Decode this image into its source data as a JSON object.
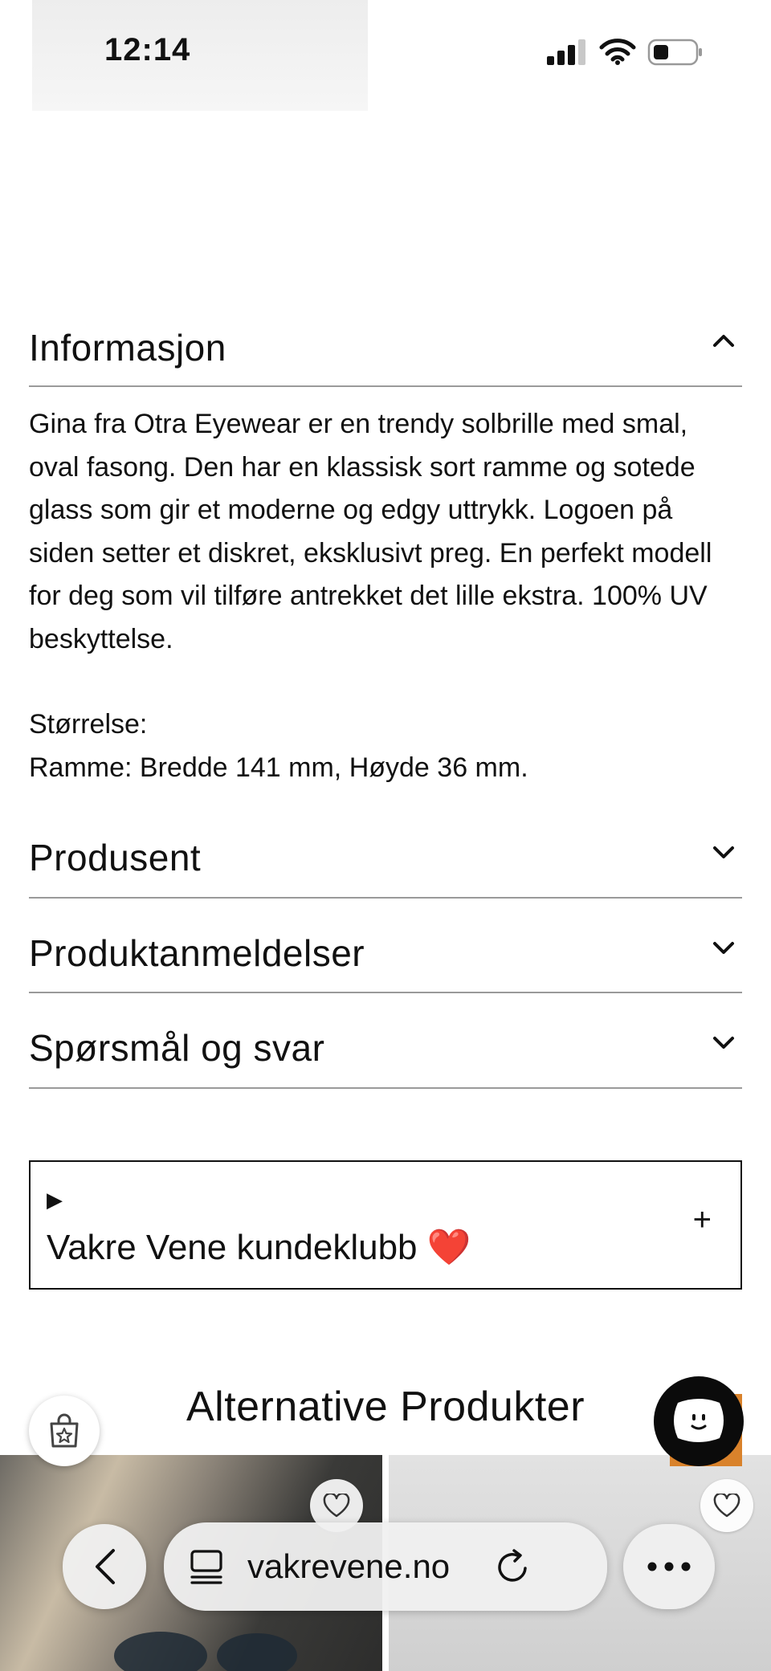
{
  "status_bar": {
    "time": "12:14"
  },
  "sections": {
    "info": {
      "title": "Informasjon",
      "paragraph": "Gina fra Otra Eyewear er en trendy solbrille med smal, oval fasong. Den har en klassisk sort ramme og sotede glass som gir et moderne og edgy uttrykk. Logoen på siden setter et diskret, eksklusivt preg. En perfekt modell for deg som vil tilføre antrekket det lille ekstra. 100% UV beskyttelse.",
      "size_label": "Størrelse:",
      "size_value": "Ramme: Bredde 141 mm, Høyde 36 mm."
    },
    "manufacturer": {
      "title": "Produsent"
    },
    "reviews": {
      "title": "Produktanmeldelser"
    },
    "qa": {
      "title": "Spørsmål og svar"
    }
  },
  "club": {
    "marker": "▶",
    "label": "Vakre Vene kundeklubb ❤️",
    "toggle": "+"
  },
  "alternatives": {
    "title": "Alternative Produkter"
  },
  "browser": {
    "url": "vakrevene.no"
  },
  "icons": {
    "expanded": "chevron-up-icon",
    "collapsed": "chevron-down-icon",
    "wishlist": "heart-icon",
    "shop": "shopping-bag-star-icon",
    "chat": "chat-face-icon",
    "back": "chevron-left-icon",
    "tabs": "tabs-icon",
    "reload": "reload-icon",
    "more": "more-icon"
  },
  "colors": {
    "accent": "#d9822b",
    "chat_bg": "#0b0b0b",
    "divider": "#9a9a9a"
  }
}
